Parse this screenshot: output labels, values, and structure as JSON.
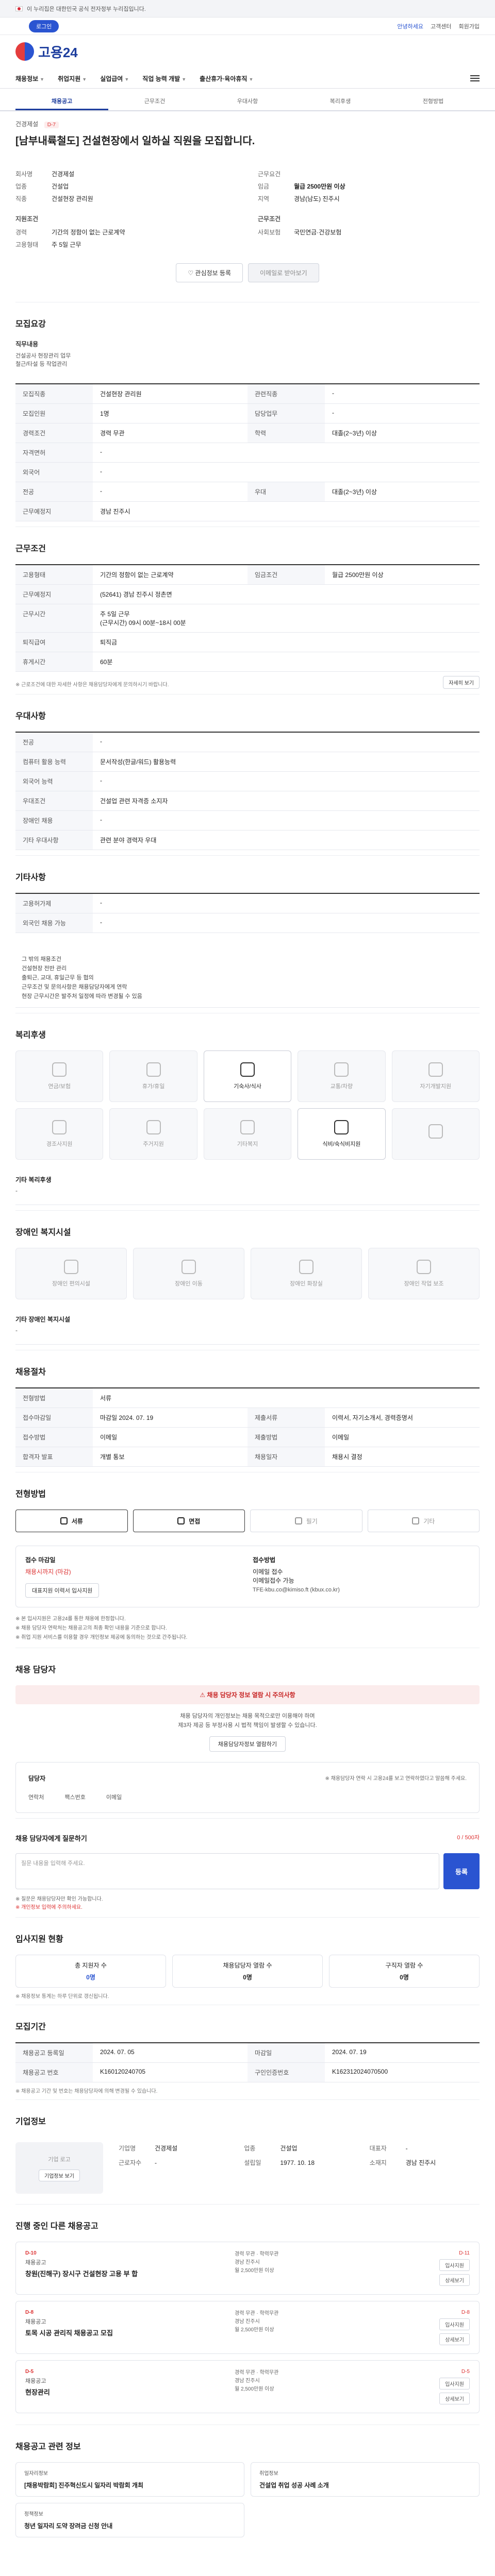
{
  "topbar": {
    "text": "이 누리집은 대한민국 공식 전자정부 누리집입니다."
  },
  "userbar": {
    "login": "로그인",
    "right_links": [
      "고객센터",
      "회원가입"
    ],
    "blue": "안녕하세요"
  },
  "logo": {
    "text": "고용24"
  },
  "gnb": {
    "items": [
      "채용정보",
      "취업지원",
      "실업급여",
      "직업 능력 개발",
      "출산휴가·육아휴직"
    ]
  },
  "tabs": [
    "채용공고",
    "근무조건",
    "우대사항",
    "복리후생",
    "전형방법"
  ],
  "summary": {
    "company": "건경제설",
    "badge": "D-7",
    "title": "[남부내륙철도] 건설현장에서 일하실 직원을 모집합니다.",
    "left": [
      {
        "k": "회사명",
        "v": "건경제설"
      },
      {
        "k": "업종",
        "v": "건설업"
      },
      {
        "k": "직종",
        "v": "건설현장 관리원"
      }
    ],
    "right": [
      {
        "k": "근무요건",
        "v": ""
      },
      {
        "k": "임금",
        "v": "월급 2500만원 이상"
      },
      {
        "k": "지역",
        "v": "경남(남도) 진주시"
      }
    ],
    "subhead_left": "지원조건",
    "subhead_right": "근무조건",
    "left2": [
      {
        "k": "경력",
        "v": "기간의 정함이 없는 근로계약"
      },
      {
        "k": "고용형태",
        "v": "주 5일 근무"
      }
    ],
    "right2": [
      {
        "k": "사회보험",
        "v": "국민연금·건강보험"
      }
    ],
    "btn_scrap": "관심정보 등록",
    "btn_apply": "이메일로 받아보기"
  },
  "s1": {
    "title": "모집요강",
    "job_desc_label": "직무내용",
    "job_desc": "건설공사 현장관리 업무\n철근/타설 등 작업관리",
    "rows": [
      {
        "a": "모집직종",
        "b": "건설현장 관리원",
        "c": "관련직종",
        "d": "-"
      },
      {
        "a": "모집인원",
        "b": "1명",
        "c": "담당업무",
        "d": "-"
      },
      {
        "a": "경력조건",
        "b": "경력 무관",
        "c": "학력",
        "d": "대졸(2~3년) 이상"
      },
      {
        "a": "자격면허",
        "b": "-",
        "c": "",
        "d": ""
      },
      {
        "a": "외국어",
        "b": "-",
        "c": "",
        "d": ""
      },
      {
        "a": "전공",
        "b": "-",
        "c": "우대",
        "d": "대졸(2~3년) 이상"
      },
      {
        "a": "근무예정지",
        "b": "경남 진주시",
        "c": "",
        "d": ""
      }
    ]
  },
  "s2": {
    "title": "근무조건",
    "rows": [
      {
        "a": "고용형태",
        "b": "기간의 정함이 없는 근로계약",
        "c": "임금조건",
        "d": "월급 2500만원 이상"
      },
      {
        "a": "근무예정지",
        "b": "(52641) 경남 진주시 정촌면",
        "c": "",
        "d": ""
      },
      {
        "a": "근무시간",
        "b": "주 5일 근무\n(근무시간) 09시 00분~18시 00분",
        "c": "",
        "d": ""
      },
      {
        "a": "퇴직급여",
        "b": "퇴직금",
        "c": "",
        "d": ""
      },
      {
        "a": "휴게시간",
        "b": "60분",
        "c": "",
        "d": ""
      }
    ],
    "link": "(지도보기)",
    "more_btn": "자세히 보기",
    "note": "※ 근로조건에 대한 자세한 사항은 채용담당자에게 문의하시기 바랍니다."
  },
  "s3": {
    "title": "우대사항",
    "rows": [
      {
        "a": "전공",
        "b": "-"
      },
      {
        "a": "컴퓨터 활용 능력",
        "b": "문서작성(한글/워드) 활용능력"
      },
      {
        "a": "외국어 능력",
        "b": "-"
      },
      {
        "a": "우대조건",
        "b": "건설업 관련 자격증 소지자"
      },
      {
        "a": "장애인 채용",
        "b": "-"
      },
      {
        "a": "기타 우대사항",
        "b": "관련 분야 경력자 우대"
      }
    ]
  },
  "s4": {
    "title": "기타사항",
    "rows": [
      {
        "a": "고용허가제",
        "b": "-"
      },
      {
        "a": "외국인 채용 가능",
        "b": "-"
      }
    ],
    "desc": "그 밖의 채용조건\n건설현장 전반 관리\n출퇴근, 교대, 휴일근무 등 협의\n근무조건 및 문의사항은 채용담당자에게 연락\n현장 근무시간은 발주처 일정에 따라 변경될 수 있음"
  },
  "s5": {
    "title": "복리후생",
    "items": [
      "연금/보험",
      "휴가/휴일",
      "기숙사/식사",
      "교통/차량",
      "자기개발지원",
      "경조사지원",
      "주거지원",
      "기타복지",
      "식비/숙식비지원",
      ""
    ],
    "active": [
      2,
      8
    ],
    "other_label": "기타 복리후생",
    "other_value": "-"
  },
  "s6": {
    "title": "장애인 복지시설",
    "items": [
      "장애인 편의시설",
      "장애인 이동",
      "장애인 화장실",
      "장애인 작업 보조"
    ],
    "other_label": "기타 장애인 복지시설",
    "other_value": "-"
  },
  "s7": {
    "title": "채용절차",
    "rows": [
      {
        "a": "전형방법",
        "b": "서류",
        "c": "",
        "d": ""
      },
      {
        "a": "접수마감일",
        "b": "마감일 2024. 07. 19",
        "c": "제출서류",
        "d": "이력서, 자기소개서, 경력증명서"
      },
      {
        "a": "접수방법",
        "b": "이메일",
        "c": "제출방법",
        "d": "이메일"
      },
      {
        "a": "합격자 발표",
        "b": "개별 통보",
        "c": "채용일자",
        "d": "채용시 결정"
      }
    ]
  },
  "s8": {
    "title": "전형방법",
    "pills": [
      "서류",
      "면접",
      "필기",
      "기타"
    ],
    "active": [
      0,
      1
    ],
    "receipt_label": "접수 마감일",
    "receipt_value": "채용시까지 (마감)",
    "contact_label": "접수방법",
    "contact_value": "이메일 접수\n이메일접수 가능",
    "contact_email": "TFE-kbu.co@kimiso.ft (kbux.co.kr)",
    "btn": "대표지원 이력서 입사지원",
    "notes": [
      "※ 본 입사지원은 고용24를 통한 채용에 한정합니다.",
      "※ 채용 담당자 연락처는 채용공고의 최종 확인 내용을 기준으로 합니다.",
      "※ 취업 지원 서비스를 이용할 경우 개인정보 제공에 동의하는 것으로 간주됩니다."
    ]
  },
  "s9": {
    "title": "채용 담당자",
    "alert": "채용 담당자 정보 열람 시 주의사항",
    "note": "채용 담당자의 개인정보는 채용 목적으로만 이용해야 하며\n제3자 제공 등 부정사용 시 법적 책임이 발생할 수 있습니다.",
    "btn": "채용담당자정보 열람하기",
    "contact_label": "담당자",
    "contact_a": "연락처",
    "contact_b": "팩스번호",
    "contact_c": "이메일",
    "contact_note": "※ 채용담당자 연락 시 고용24를 보고 연락하였다고 말씀해 주세요."
  },
  "s10": {
    "title": "채용 담당자에게 질문하기",
    "counter": "0 / 500자",
    "placeholder": "질문 내용을 입력해 주세요.",
    "submit": "등록",
    "notes": [
      "※ 질문은 채용담당자만 확인 가능합니다.",
      "※ 개인정보 입력에 주의하세요."
    ]
  },
  "s11": {
    "title": "입사지원 현황",
    "stats": [
      {
        "k": "총 지원자 수",
        "v": "0명"
      },
      {
        "k": "채용담당자 열람 수",
        "v": "0명"
      },
      {
        "k": "구직자 열람 수",
        "v": "0명"
      }
    ],
    "note": "※ 채용정보 통계는 하루 단위로 갱신됩니다."
  },
  "s12": {
    "title": "모집기간",
    "rows": [
      {
        "a": "채용공고 등록일",
        "b": "2024. 07. 05",
        "c": "마감일",
        "d": "2024. 07. 19"
      },
      {
        "a": "채용공고 번호",
        "b": "K160120240705",
        "c": "구인인증번호",
        "d": "K162312024070500"
      }
    ],
    "note": "※ 채용공고 기간 및 번호는 채용담당자에 의해 변경될 수 있습니다."
  },
  "s13": {
    "title": "기업정보",
    "logo_text": "기업 로고",
    "logo_btn": "기업정보 보기",
    "rows": [
      {
        "k": "기업명",
        "v": "건경제설"
      },
      {
        "k": "업종",
        "v": "건설업"
      },
      {
        "k": "대표자",
        "v": "-"
      },
      {
        "k": "근로자수",
        "v": "-"
      },
      {
        "k": "설립일",
        "v": "1977. 10. 18"
      },
      {
        "k": "소재지",
        "v": "경남 진주시"
      }
    ]
  },
  "s14": {
    "title": "진행 중인 다른 채용공고",
    "jobs": [
      {
        "dday": "D-10",
        "co": "채용공고",
        "title": "창원(진해구) 장시구 건설현장 고용 부 합",
        "meta": "경력 무관 · 학력무관\n경남 진주시\n월 2,500만원 이상",
        "tag": "D-11"
      },
      {
        "dday": "D-8",
        "co": "채용공고",
        "title": "토목 시공 관리직 채용공고 모집",
        "meta": "경력 무관 · 학력무관\n경남 진주시\n월 2,500만원 이상",
        "tag": "D-8"
      },
      {
        "dday": "D-5",
        "co": "채용공고",
        "title": "현장관리",
        "meta": "경력 무관 · 학력무관\n경남 진주시\n월 2,500만원 이상",
        "tag": "D-5"
      }
    ],
    "apply": "입사지원",
    "view": "상세보기"
  },
  "s15": {
    "title": "채용공고 관련 정보",
    "news": [
      {
        "tag": "일자리정보",
        "title": "[채용박람회] 진주혁신도시 일자리 박람회 개최"
      },
      {
        "tag": "취업정보",
        "title": "건설업 취업 성공 사례 소개"
      },
      {
        "tag": "정책정보",
        "title": "청년 일자리 도약 장려금 신청 안내"
      }
    ]
  }
}
